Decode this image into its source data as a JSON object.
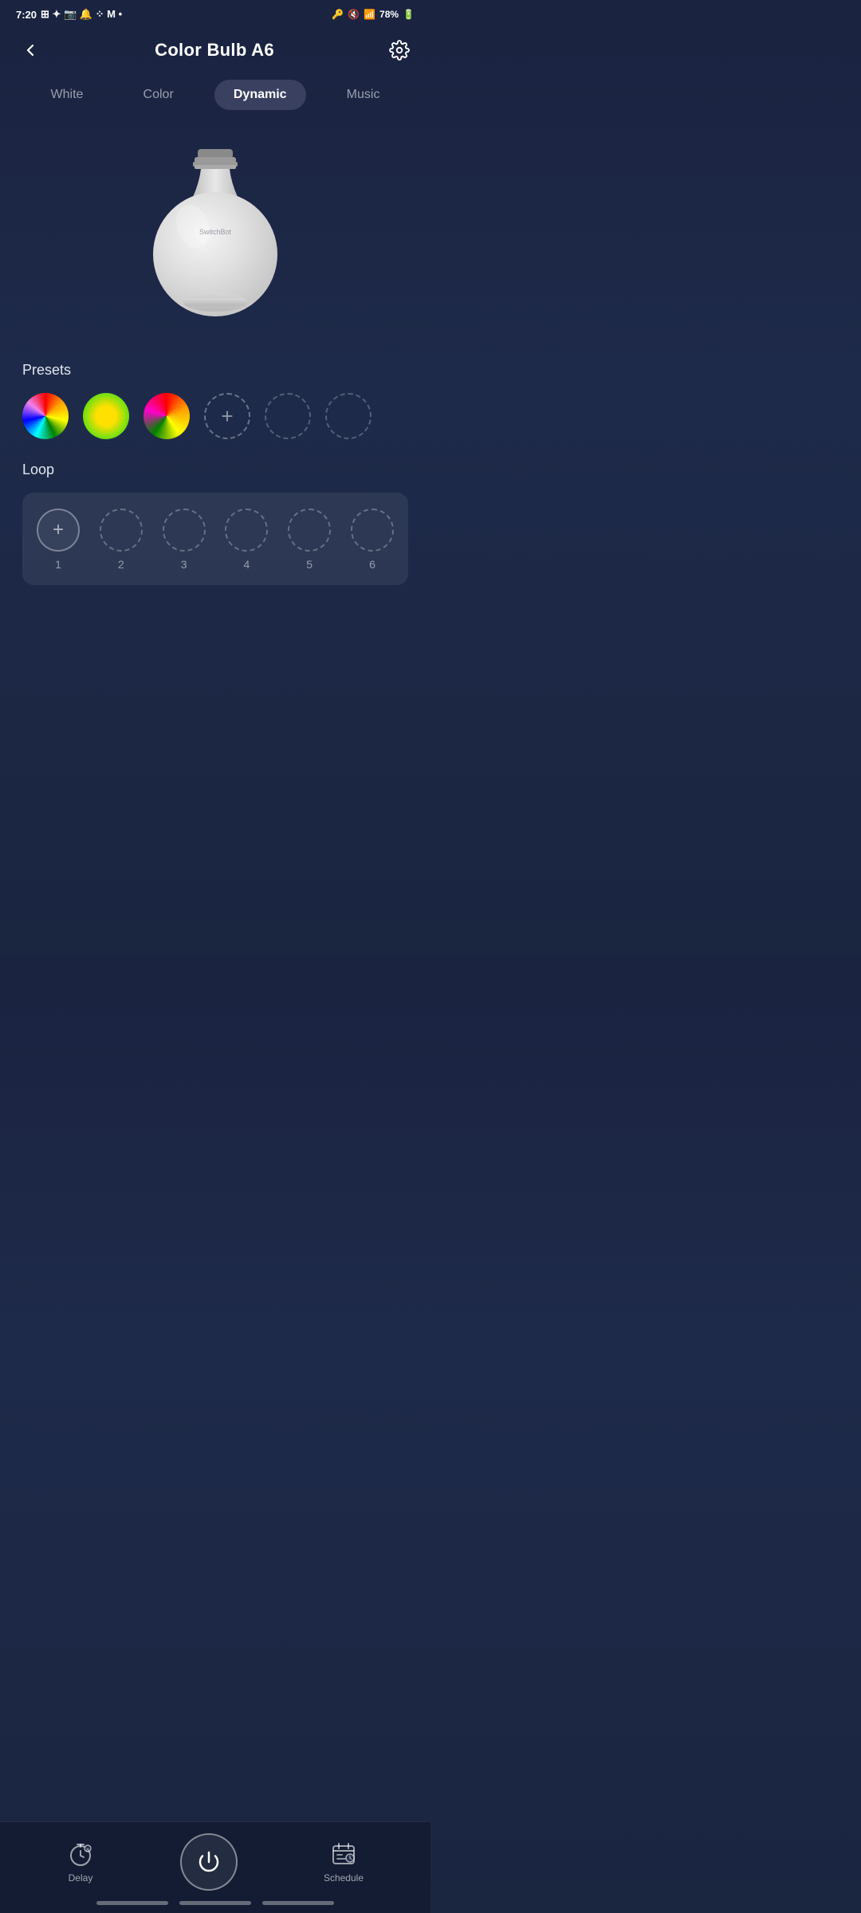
{
  "statusBar": {
    "time": "7:20",
    "battery": "78%"
  },
  "header": {
    "title": "Color Bulb A6",
    "backLabel": "back",
    "settingsLabel": "settings"
  },
  "tabs": [
    {
      "id": "white",
      "label": "White",
      "active": false
    },
    {
      "id": "color",
      "label": "Color",
      "active": false
    },
    {
      "id": "dynamic",
      "label": "Dynamic",
      "active": true
    },
    {
      "id": "music",
      "label": "Music",
      "active": false
    }
  ],
  "bulb": {
    "brand": "SwitchBot"
  },
  "presetsSection": {
    "title": "Presets",
    "addLabel": "+",
    "presets": [
      {
        "id": "preset-1",
        "type": "rainbow-full"
      },
      {
        "id": "preset-2",
        "type": "rainbow-yellow-green"
      },
      {
        "id": "preset-3",
        "type": "rainbow-red-pink"
      }
    ],
    "emptySlots": 3
  },
  "loopSection": {
    "title": "Loop",
    "addLabel": "+",
    "slots": [
      1,
      2,
      3,
      4,
      5,
      6
    ]
  },
  "bottomBar": {
    "delayLabel": "Delay",
    "scheduleLabel": "Schedule",
    "powerLabel": "power"
  }
}
